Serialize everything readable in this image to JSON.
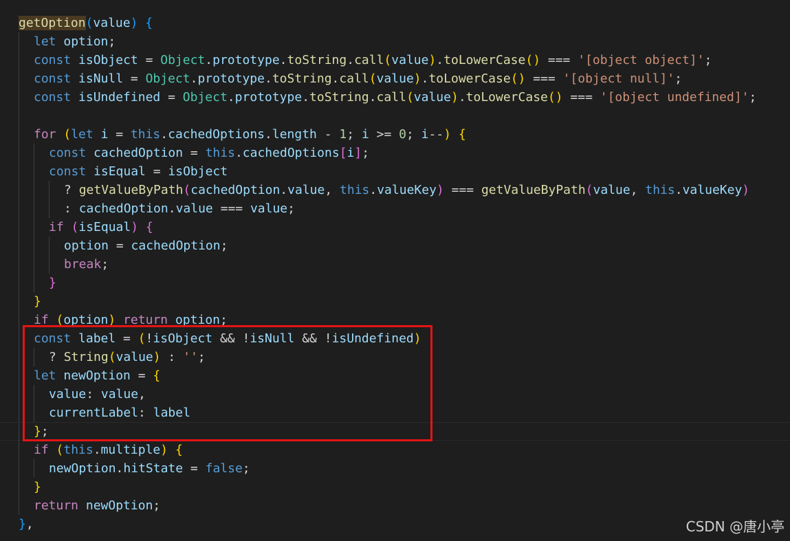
{
  "code_lines": [
    {
      "indent": 0,
      "tokens": [
        {
          "t": "getOption",
          "c": "t-fn fn-hl"
        },
        {
          "t": "(",
          "c": "t-p3"
        },
        {
          "t": "value",
          "c": "t-var"
        },
        {
          "t": ")",
          "c": "t-p3"
        },
        {
          "t": " ",
          "c": "t-plain"
        },
        {
          "t": "{",
          "c": "t-p3"
        }
      ]
    },
    {
      "indent": 1,
      "tokens": [
        {
          "t": "let",
          "c": "t-kw"
        },
        {
          "t": " ",
          "c": "t-plain"
        },
        {
          "t": "option",
          "c": "t-var"
        },
        {
          "t": ";",
          "c": "t-plain"
        }
      ]
    },
    {
      "indent": 1,
      "tokens": [
        {
          "t": "const",
          "c": "t-kw"
        },
        {
          "t": " ",
          "c": "t-plain"
        },
        {
          "t": "isObject",
          "c": "t-var"
        },
        {
          "t": " = ",
          "c": "t-op"
        },
        {
          "t": "Object",
          "c": "t-type"
        },
        {
          "t": ".",
          "c": "t-plain"
        },
        {
          "t": "prototype",
          "c": "t-prop"
        },
        {
          "t": ".",
          "c": "t-plain"
        },
        {
          "t": "toString",
          "c": "t-fn"
        },
        {
          "t": ".",
          "c": "t-plain"
        },
        {
          "t": "call",
          "c": "t-fn"
        },
        {
          "t": "(",
          "c": "t-p1"
        },
        {
          "t": "value",
          "c": "t-var"
        },
        {
          "t": ")",
          "c": "t-p1"
        },
        {
          "t": ".",
          "c": "t-plain"
        },
        {
          "t": "toLowerCase",
          "c": "t-fn"
        },
        {
          "t": "()",
          "c": "t-p1"
        },
        {
          "t": " === ",
          "c": "t-op"
        },
        {
          "t": "'[object object]'",
          "c": "t-str"
        },
        {
          "t": ";",
          "c": "t-plain"
        }
      ]
    },
    {
      "indent": 1,
      "tokens": [
        {
          "t": "const",
          "c": "t-kw"
        },
        {
          "t": " ",
          "c": "t-plain"
        },
        {
          "t": "isNull",
          "c": "t-var"
        },
        {
          "t": " = ",
          "c": "t-op"
        },
        {
          "t": "Object",
          "c": "t-type"
        },
        {
          "t": ".",
          "c": "t-plain"
        },
        {
          "t": "prototype",
          "c": "t-prop"
        },
        {
          "t": ".",
          "c": "t-plain"
        },
        {
          "t": "toString",
          "c": "t-fn"
        },
        {
          "t": ".",
          "c": "t-plain"
        },
        {
          "t": "call",
          "c": "t-fn"
        },
        {
          "t": "(",
          "c": "t-p1"
        },
        {
          "t": "value",
          "c": "t-var"
        },
        {
          "t": ")",
          "c": "t-p1"
        },
        {
          "t": ".",
          "c": "t-plain"
        },
        {
          "t": "toLowerCase",
          "c": "t-fn"
        },
        {
          "t": "()",
          "c": "t-p1"
        },
        {
          "t": " === ",
          "c": "t-op"
        },
        {
          "t": "'[object null]'",
          "c": "t-str"
        },
        {
          "t": ";",
          "c": "t-plain"
        }
      ]
    },
    {
      "indent": 1,
      "tokens": [
        {
          "t": "const",
          "c": "t-kw"
        },
        {
          "t": " ",
          "c": "t-plain"
        },
        {
          "t": "isUndefined",
          "c": "t-var"
        },
        {
          "t": " = ",
          "c": "t-op"
        },
        {
          "t": "Object",
          "c": "t-type"
        },
        {
          "t": ".",
          "c": "t-plain"
        },
        {
          "t": "prototype",
          "c": "t-prop"
        },
        {
          "t": ".",
          "c": "t-plain"
        },
        {
          "t": "toString",
          "c": "t-fn"
        },
        {
          "t": ".",
          "c": "t-plain"
        },
        {
          "t": "call",
          "c": "t-fn"
        },
        {
          "t": "(",
          "c": "t-p1"
        },
        {
          "t": "value",
          "c": "t-var"
        },
        {
          "t": ")",
          "c": "t-p1"
        },
        {
          "t": ".",
          "c": "t-plain"
        },
        {
          "t": "toLowerCase",
          "c": "t-fn"
        },
        {
          "t": "()",
          "c": "t-p1"
        },
        {
          "t": " === ",
          "c": "t-op"
        },
        {
          "t": "'[object undefined]'",
          "c": "t-str"
        },
        {
          "t": ";",
          "c": "t-plain"
        }
      ]
    },
    {
      "indent": 1,
      "tokens": []
    },
    {
      "indent": 1,
      "tokens": [
        {
          "t": "for",
          "c": "t-ctrl"
        },
        {
          "t": " ",
          "c": "t-plain"
        },
        {
          "t": "(",
          "c": "t-p1"
        },
        {
          "t": "let",
          "c": "t-kw"
        },
        {
          "t": " ",
          "c": "t-plain"
        },
        {
          "t": "i",
          "c": "t-var"
        },
        {
          "t": " = ",
          "c": "t-op"
        },
        {
          "t": "this",
          "c": "t-kw"
        },
        {
          "t": ".",
          "c": "t-plain"
        },
        {
          "t": "cachedOptions",
          "c": "t-var"
        },
        {
          "t": ".",
          "c": "t-plain"
        },
        {
          "t": "length",
          "c": "t-var"
        },
        {
          "t": " - ",
          "c": "t-op"
        },
        {
          "t": "1",
          "c": "t-num"
        },
        {
          "t": "; ",
          "c": "t-plain"
        },
        {
          "t": "i",
          "c": "t-var"
        },
        {
          "t": " >= ",
          "c": "t-op"
        },
        {
          "t": "0",
          "c": "t-num"
        },
        {
          "t": "; ",
          "c": "t-plain"
        },
        {
          "t": "i",
          "c": "t-var"
        },
        {
          "t": "--",
          "c": "t-op"
        },
        {
          "t": ")",
          "c": "t-p1"
        },
        {
          "t": " ",
          "c": "t-plain"
        },
        {
          "t": "{",
          "c": "t-p1"
        }
      ]
    },
    {
      "indent": 2,
      "tokens": [
        {
          "t": "const",
          "c": "t-kw"
        },
        {
          "t": " ",
          "c": "t-plain"
        },
        {
          "t": "cachedOption",
          "c": "t-var"
        },
        {
          "t": " = ",
          "c": "t-op"
        },
        {
          "t": "this",
          "c": "t-kw"
        },
        {
          "t": ".",
          "c": "t-plain"
        },
        {
          "t": "cachedOptions",
          "c": "t-var"
        },
        {
          "t": "[",
          "c": "t-p2"
        },
        {
          "t": "i",
          "c": "t-var"
        },
        {
          "t": "]",
          "c": "t-p2"
        },
        {
          "t": ";",
          "c": "t-plain"
        }
      ]
    },
    {
      "indent": 2,
      "tokens": [
        {
          "t": "const",
          "c": "t-kw"
        },
        {
          "t": " ",
          "c": "t-plain"
        },
        {
          "t": "isEqual",
          "c": "t-var"
        },
        {
          "t": " = ",
          "c": "t-op"
        },
        {
          "t": "isObject",
          "c": "t-var"
        }
      ]
    },
    {
      "indent": 3,
      "tokens": [
        {
          "t": "? ",
          "c": "t-op"
        },
        {
          "t": "getValueByPath",
          "c": "t-fn"
        },
        {
          "t": "(",
          "c": "t-p2"
        },
        {
          "t": "cachedOption",
          "c": "t-var"
        },
        {
          "t": ".",
          "c": "t-plain"
        },
        {
          "t": "value",
          "c": "t-var"
        },
        {
          "t": ", ",
          "c": "t-plain"
        },
        {
          "t": "this",
          "c": "t-kw"
        },
        {
          "t": ".",
          "c": "t-plain"
        },
        {
          "t": "valueKey",
          "c": "t-var"
        },
        {
          "t": ")",
          "c": "t-p2"
        },
        {
          "t": " === ",
          "c": "t-op"
        },
        {
          "t": "getValueByPath",
          "c": "t-fn"
        },
        {
          "t": "(",
          "c": "t-p2"
        },
        {
          "t": "value",
          "c": "t-var"
        },
        {
          "t": ", ",
          "c": "t-plain"
        },
        {
          "t": "this",
          "c": "t-kw"
        },
        {
          "t": ".",
          "c": "t-plain"
        },
        {
          "t": "valueKey",
          "c": "t-var"
        },
        {
          "t": ")",
          "c": "t-p2"
        }
      ]
    },
    {
      "indent": 3,
      "tokens": [
        {
          "t": ": ",
          "c": "t-op"
        },
        {
          "t": "cachedOption",
          "c": "t-var"
        },
        {
          "t": ".",
          "c": "t-plain"
        },
        {
          "t": "value",
          "c": "t-var"
        },
        {
          "t": " === ",
          "c": "t-op"
        },
        {
          "t": "value",
          "c": "t-var"
        },
        {
          "t": ";",
          "c": "t-plain"
        }
      ]
    },
    {
      "indent": 2,
      "tokens": [
        {
          "t": "if",
          "c": "t-ctrl"
        },
        {
          "t": " ",
          "c": "t-plain"
        },
        {
          "t": "(",
          "c": "t-p2"
        },
        {
          "t": "isEqual",
          "c": "t-var"
        },
        {
          "t": ")",
          "c": "t-p2"
        },
        {
          "t": " ",
          "c": "t-plain"
        },
        {
          "t": "{",
          "c": "t-p2"
        }
      ]
    },
    {
      "indent": 3,
      "tokens": [
        {
          "t": "option",
          "c": "t-var"
        },
        {
          "t": " = ",
          "c": "t-op"
        },
        {
          "t": "cachedOption",
          "c": "t-var"
        },
        {
          "t": ";",
          "c": "t-plain"
        }
      ]
    },
    {
      "indent": 3,
      "tokens": [
        {
          "t": "break",
          "c": "t-ctrl"
        },
        {
          "t": ";",
          "c": "t-plain"
        }
      ]
    },
    {
      "indent": 2,
      "tokens": [
        {
          "t": "}",
          "c": "t-p2"
        }
      ]
    },
    {
      "indent": 1,
      "tokens": [
        {
          "t": "}",
          "c": "t-p1"
        }
      ]
    },
    {
      "indent": 1,
      "tokens": [
        {
          "t": "if",
          "c": "t-ctrl"
        },
        {
          "t": " ",
          "c": "t-plain"
        },
        {
          "t": "(",
          "c": "t-p1"
        },
        {
          "t": "option",
          "c": "t-var"
        },
        {
          "t": ")",
          "c": "t-p1"
        },
        {
          "t": " ",
          "c": "t-plain"
        },
        {
          "t": "return",
          "c": "t-ctrl"
        },
        {
          "t": " ",
          "c": "t-plain"
        },
        {
          "t": "option",
          "c": "t-var"
        },
        {
          "t": ";",
          "c": "t-plain"
        }
      ]
    },
    {
      "indent": 1,
      "tokens": [
        {
          "t": "const",
          "c": "t-kw"
        },
        {
          "t": " ",
          "c": "t-plain"
        },
        {
          "t": "label",
          "c": "t-var"
        },
        {
          "t": " = ",
          "c": "t-op"
        },
        {
          "t": "(",
          "c": "t-p1"
        },
        {
          "t": "!",
          "c": "t-op"
        },
        {
          "t": "isObject",
          "c": "t-var"
        },
        {
          "t": " && ",
          "c": "t-op"
        },
        {
          "t": "!",
          "c": "t-op"
        },
        {
          "t": "isNull",
          "c": "t-var"
        },
        {
          "t": " && ",
          "c": "t-op"
        },
        {
          "t": "!",
          "c": "t-op"
        },
        {
          "t": "isUndefined",
          "c": "t-var"
        },
        {
          "t": ")",
          "c": "t-p1"
        }
      ]
    },
    {
      "indent": 2,
      "tokens": [
        {
          "t": "? ",
          "c": "t-op"
        },
        {
          "t": "String",
          "c": "t-fn"
        },
        {
          "t": "(",
          "c": "t-p1"
        },
        {
          "t": "value",
          "c": "t-var"
        },
        {
          "t": ")",
          "c": "t-p1"
        },
        {
          "t": " : ",
          "c": "t-op"
        },
        {
          "t": "''",
          "c": "t-str"
        },
        {
          "t": ";",
          "c": "t-plain"
        }
      ]
    },
    {
      "indent": 1,
      "tokens": [
        {
          "t": "let",
          "c": "t-kw"
        },
        {
          "t": " ",
          "c": "t-plain"
        },
        {
          "t": "newOption",
          "c": "t-var"
        },
        {
          "t": " = ",
          "c": "t-op"
        },
        {
          "t": "{",
          "c": "t-p1"
        }
      ]
    },
    {
      "indent": 2,
      "tokens": [
        {
          "t": "value",
          "c": "t-var"
        },
        {
          "t": ": ",
          "c": "t-plain"
        },
        {
          "t": "value",
          "c": "t-var"
        },
        {
          "t": ",",
          "c": "t-plain"
        }
      ]
    },
    {
      "indent": 2,
      "tokens": [
        {
          "t": "currentLabel",
          "c": "t-var"
        },
        {
          "t": ": ",
          "c": "t-plain"
        },
        {
          "t": "label",
          "c": "t-var"
        }
      ]
    },
    {
      "indent": 1,
      "current": true,
      "tokens": [
        {
          "t": "}",
          "c": "t-p1"
        },
        {
          "t": ";",
          "c": "t-plain"
        }
      ]
    },
    {
      "indent": 1,
      "tokens": [
        {
          "t": "if",
          "c": "t-ctrl"
        },
        {
          "t": " ",
          "c": "t-plain"
        },
        {
          "t": "(",
          "c": "t-p1"
        },
        {
          "t": "this",
          "c": "t-kw"
        },
        {
          "t": ".",
          "c": "t-plain"
        },
        {
          "t": "multiple",
          "c": "t-var"
        },
        {
          "t": ")",
          "c": "t-p1"
        },
        {
          "t": " ",
          "c": "t-plain"
        },
        {
          "t": "{",
          "c": "t-p1"
        }
      ]
    },
    {
      "indent": 2,
      "tokens": [
        {
          "t": "newOption",
          "c": "t-var"
        },
        {
          "t": ".",
          "c": "t-plain"
        },
        {
          "t": "hitState",
          "c": "t-var"
        },
        {
          "t": " = ",
          "c": "t-op"
        },
        {
          "t": "false",
          "c": "t-kw"
        },
        {
          "t": ";",
          "c": "t-plain"
        }
      ]
    },
    {
      "indent": 1,
      "tokens": [
        {
          "t": "}",
          "c": "t-p1"
        }
      ]
    },
    {
      "indent": 1,
      "tokens": [
        {
          "t": "return",
          "c": "t-ctrl"
        },
        {
          "t": " ",
          "c": "t-plain"
        },
        {
          "t": "newOption",
          "c": "t-var"
        },
        {
          "t": ";",
          "c": "t-plain"
        }
      ]
    },
    {
      "indent": 0,
      "tokens": [
        {
          "t": "}",
          "c": "t-p3"
        },
        {
          "t": ",",
          "c": "t-plain"
        }
      ]
    }
  ],
  "watermark": "CSDN @唐小亭",
  "colors": {
    "background": "#1e1e1e",
    "annotation_box": "#e51414"
  }
}
